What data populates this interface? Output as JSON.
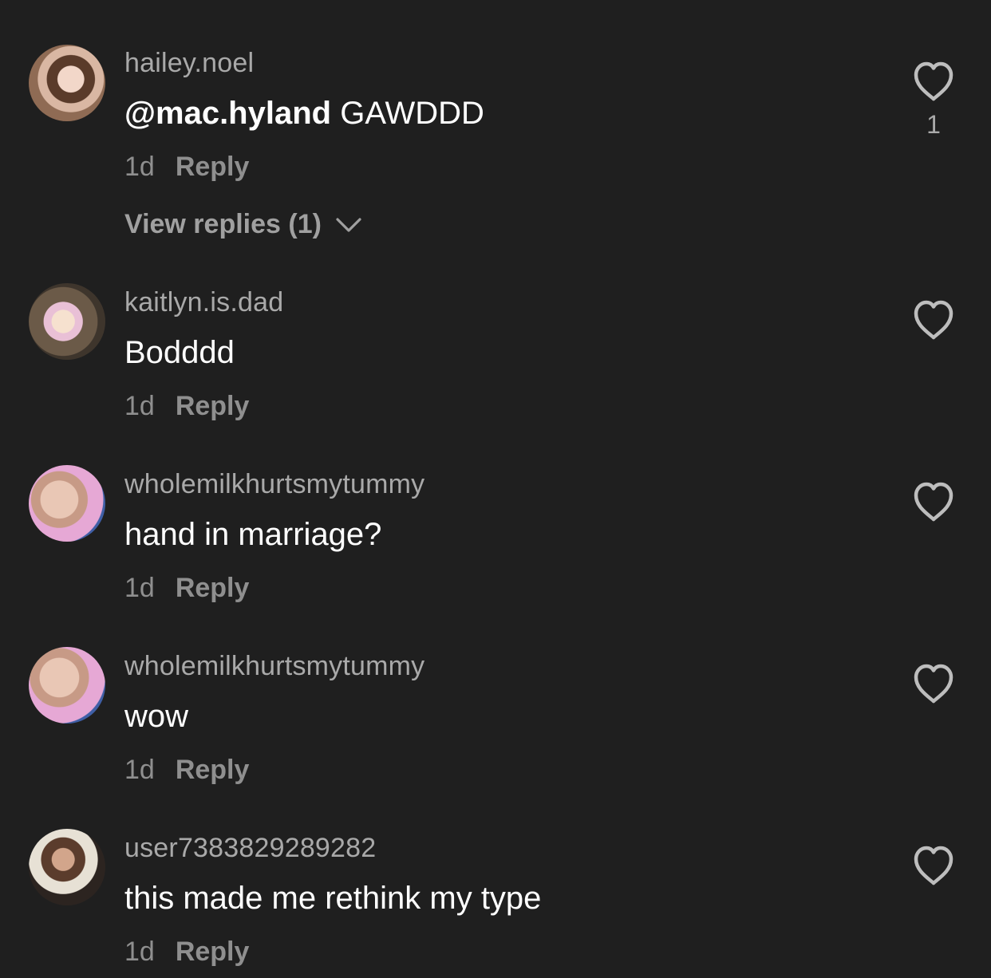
{
  "top_cut_text": "",
  "comments": [
    {
      "username": "hailey.noel",
      "mention": "@mac.hyland",
      "text": " GAWDDD",
      "time": "1d",
      "reply_label": "Reply",
      "view_replies": "View replies (1)",
      "likes": "1"
    },
    {
      "username": "kaitlyn.is.dad",
      "text": "Bodddd",
      "time": "1d",
      "reply_label": "Reply"
    },
    {
      "username": "wholemilkhurtsmytummy",
      "text": "hand in marriage?",
      "time": "1d",
      "reply_label": "Reply"
    },
    {
      "username": "wholemilkhurtsmytummy",
      "text": "wow",
      "time": "1d",
      "reply_label": "Reply"
    },
    {
      "username": "user7383829289282",
      "text": "this made me rethink my type",
      "time": "1d",
      "reply_label": "Reply"
    }
  ],
  "icons": {
    "like": "heart-outline-icon",
    "expand": "chevron-down-icon"
  },
  "colors": {
    "background": "#1f1f1f",
    "username": "#a9a9a9",
    "meta": "#8f8f8f",
    "text": "#ffffff"
  }
}
